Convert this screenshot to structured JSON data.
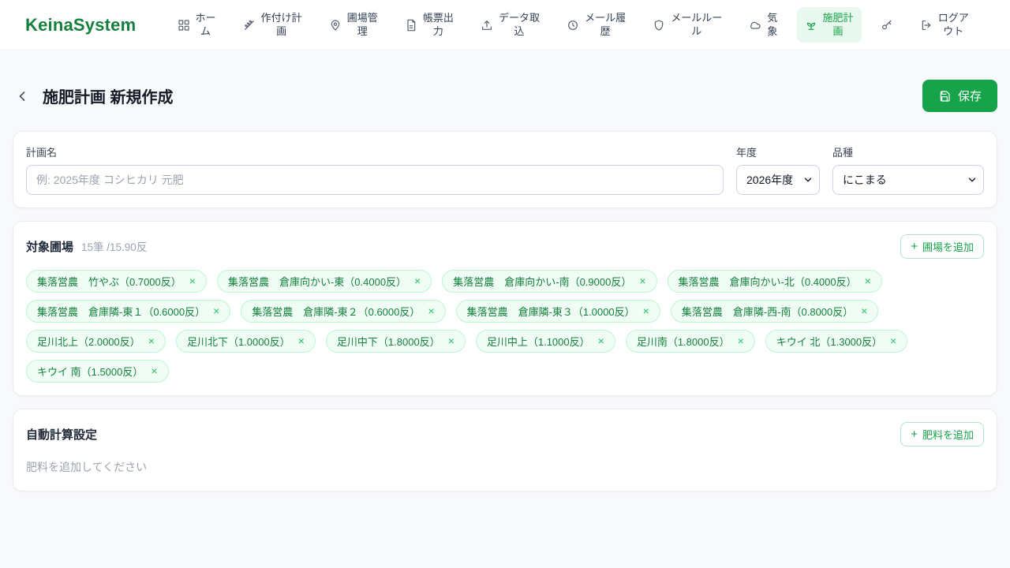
{
  "brand": {
    "name": "KeinaSystem"
  },
  "nav": {
    "items": [
      {
        "label": "ホー\nム",
        "icon": "grid-icon"
      },
      {
        "label": "作付け計\n画",
        "icon": "wheat-icon"
      },
      {
        "label": "圃場管\n理",
        "icon": "map-pin-icon"
      },
      {
        "label": "帳票出\n力",
        "icon": "document-icon"
      },
      {
        "label": "データ取\n込",
        "icon": "upload-icon"
      },
      {
        "label": "メール履\n歴",
        "icon": "history-icon"
      },
      {
        "label": "メールルー\nル",
        "icon": "shield-icon"
      },
      {
        "label": "気\n象",
        "icon": "cloud-icon"
      },
      {
        "label": "施肥計\n画",
        "icon": "sprout-icon",
        "active": true
      },
      {
        "label": "",
        "icon": "key-icon"
      },
      {
        "label": "ログア\nウト",
        "icon": "logout-icon"
      }
    ]
  },
  "header": {
    "title": "施肥計画 新規作成",
    "save_label": "保存"
  },
  "plan_form": {
    "name_label": "計画名",
    "name_placeholder": "例: 2025年度 コシヒカリ 元肥",
    "name_value": "",
    "year_label": "年度",
    "year_value": "2026年度",
    "variety_label": "品種",
    "variety_value": "にこまる"
  },
  "fields": {
    "title": "対象圃場",
    "summary": "15筆 /15.90反",
    "plus_glyph": "+",
    "add_label": "圃場を追加",
    "remove_glyph": "×",
    "tags": [
      "集落営農　竹やぶ（0.7000反）",
      "集落営農　倉庫向かい-東（0.4000反）",
      "集落営農　倉庫向かい-南（0.9000反）",
      "集落営農　倉庫向かい-北（0.4000反）",
      "集落営農　倉庫隣-東１（0.6000反）",
      "集落営農　倉庫隣-東２（0.6000反）",
      "集落営農　倉庫隣-東３（1.0000反）",
      "集落営農　倉庫隣-西-南（0.8000反）",
      "足川北上（2.0000反）",
      "足川北下（1.0000反）",
      "足川中下（1.8000反）",
      "足川中上（1.1000反）",
      "足川南（1.8000反）",
      "キウイ 北（1.3000反）",
      "キウイ 南（1.5000反）"
    ]
  },
  "auto_calc": {
    "title": "自動計算設定",
    "plus_glyph": "+",
    "add_label": "肥料を追加",
    "empty_text": "肥料を追加してください"
  },
  "colors": {
    "primary": "#16a34a",
    "brand_green": "#15803d",
    "active_nav_bg": "#e9f8ef",
    "tag_bg": "#f0fdf4",
    "tag_border": "#bbf7d0",
    "page_bg": "#f8f9fa"
  }
}
